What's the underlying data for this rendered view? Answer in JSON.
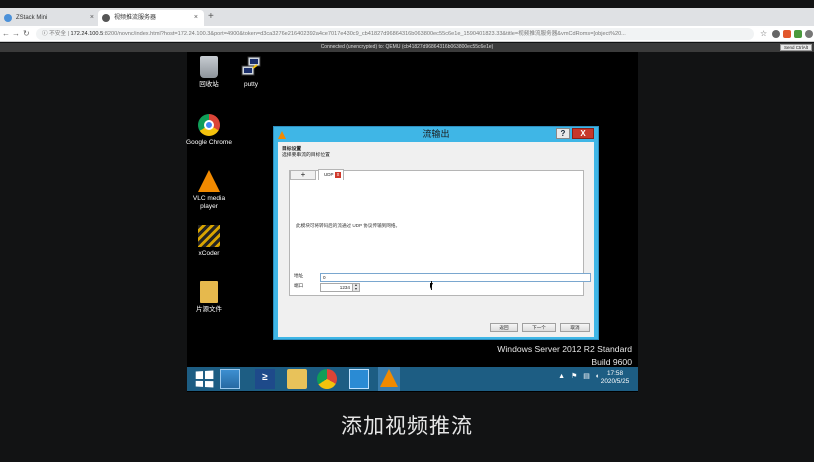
{
  "browser": {
    "tabs": [
      {
        "label": "ZStack Mini"
      },
      {
        "label": "视频推流服务器"
      }
    ],
    "new_tab_symbol": "+",
    "security_label": "不安全",
    "url_host": "172.24.100.5",
    "url_rest": ":8200/novnc/index.html?host=172.24.100.3&port=4900&token=d3ca3276e216402392a4ce7017e430c9_cb41827d96864316b063800ec55c6e1e_1590401823.33&title=视频推流服务器&vmCdRoms=[object%20..."
  },
  "vnc": {
    "status": "Connected (unencrypted) to: QEMU (cb41827d96864316b063800ec55c6e1e)",
    "send_button": "Send CtrlAlt"
  },
  "desktop_icons": {
    "recycle": "回收站",
    "putty": "putty",
    "chrome": "Google Chrome",
    "vlc": "VLC media player",
    "xcoder": "xCoder",
    "films": "片源文件"
  },
  "dialog": {
    "title": "流输出",
    "help": "?",
    "close": "X",
    "heading": "目标设置",
    "subheading": "选择要串流的目标位置",
    "tab_add": "+",
    "tab_udp": "UDP",
    "tab_close": "x",
    "description": "此模块可将转码后的流通过 UDP 协议传输到网络。",
    "address_label": "地址",
    "address_value": "0",
    "port_label": "端口",
    "port_value": "1234",
    "back": "返回",
    "next": "下一个",
    "cancel": "取消"
  },
  "watermark": {
    "line1": "Windows Server 2012 R2 Standard",
    "line2": "Build 9600"
  },
  "clock": {
    "time": "17:58",
    "date": "2020/5/25"
  },
  "subtitle": "添加视频推流"
}
